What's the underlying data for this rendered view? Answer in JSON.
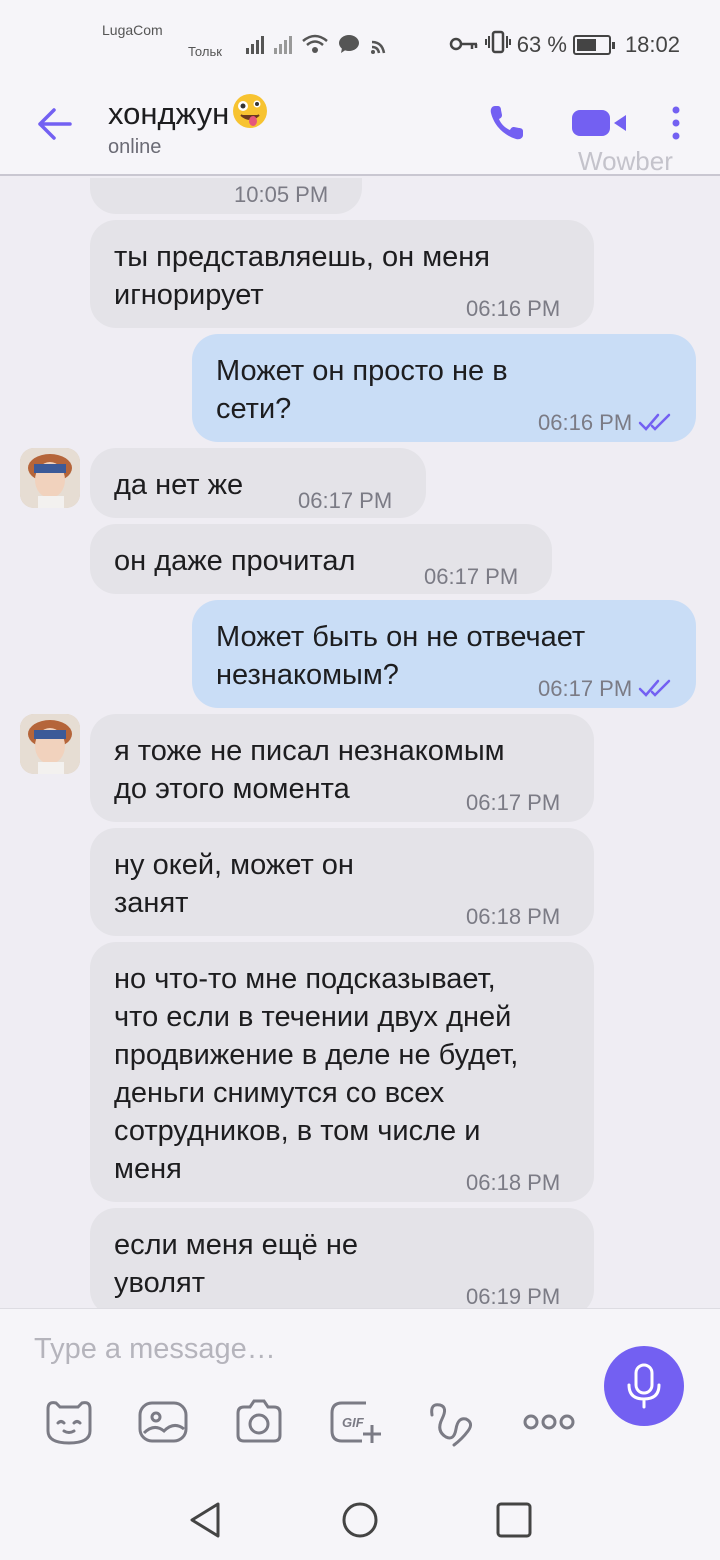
{
  "status_bar": {
    "carrier_top": "LugaCom",
    "carrier_bottom": "Тольк",
    "battery_text": "63 %",
    "battery_level": 0.63,
    "time": "18:02"
  },
  "header": {
    "contact_name": "хонджун",
    "contact_status": "online",
    "watermark": "Wowber"
  },
  "messages": [
    {
      "direction": "in",
      "text": "",
      "time": "10:05 PM",
      "partial": true
    },
    {
      "direction": "in",
      "text": "ты представляешь, он меня\nигнорирует",
      "time": "06:16 PM"
    },
    {
      "direction": "out",
      "text": "Может он просто не в\nсети?",
      "time": "06:16 PM",
      "read": true
    },
    {
      "direction": "in",
      "text": "да нет же",
      "time": "06:17 PM",
      "avatar": true
    },
    {
      "direction": "in",
      "text": "он даже прочитал",
      "time": "06:17 PM"
    },
    {
      "direction": "out",
      "text": "Может быть он не отвечает\nнезнакомым?",
      "time": "06:17 PM",
      "read": true
    },
    {
      "direction": "in",
      "text": "я тоже не писал незнакомым\nдо этого момента",
      "time": "06:17 PM",
      "avatar": true
    },
    {
      "direction": "in",
      "text": "ну окей, может он\nзанят",
      "time": "06:18 PM"
    },
    {
      "direction": "in",
      "text": "но что-то мне подсказывает,\nчто если в течении двух дней\nпродвижение в деле не будет,\nденьги снимутся со всех\nсотрудников, в том числе и\nменя",
      "time": "06:18 PM"
    },
    {
      "direction": "in",
      "text": "если меня ещё не\nуволят",
      "time": "06:19 PM"
    }
  ],
  "composer": {
    "placeholder": "Type a message…",
    "tools": [
      "sticker-icon",
      "gallery-icon",
      "camera-icon",
      "gif-icon",
      "doodle-icon",
      "more-options-icon"
    ]
  },
  "colors": {
    "accent": "#7360f2",
    "incoming_bubble": "#e4e3e8",
    "outgoing_bubble": "#c9ddf6",
    "background": "#efedf3"
  }
}
